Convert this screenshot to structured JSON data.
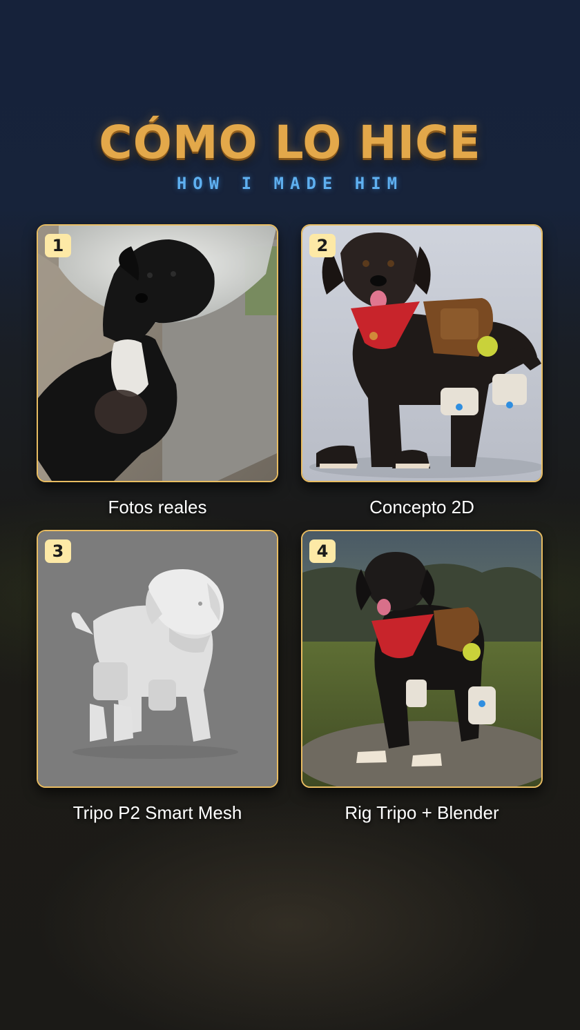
{
  "header": {
    "title": "CÓMO LO HICE",
    "subtitle": "HOW I MADE HIM"
  },
  "steps": [
    {
      "number": "1",
      "caption": "Fotos reales",
      "image": "real-photo-of-black-dog-with-cone"
    },
    {
      "number": "2",
      "caption": "Concepto 2D",
      "image": "2d-concept-dog-with-red-bandana-and-gear"
    },
    {
      "number": "3",
      "caption": "Tripo P2 Smart Mesh",
      "image": "grey-3d-mesh-of-dog"
    },
    {
      "number": "4",
      "caption": "Rig Tripo + Blender",
      "image": "rendered-3d-dog-in-field"
    }
  ],
  "colors": {
    "title_gold": "#e3a84a",
    "subtitle_blue": "#5fb0f0",
    "card_border": "#e9bd62",
    "badge_bg": "#fde9a6"
  }
}
